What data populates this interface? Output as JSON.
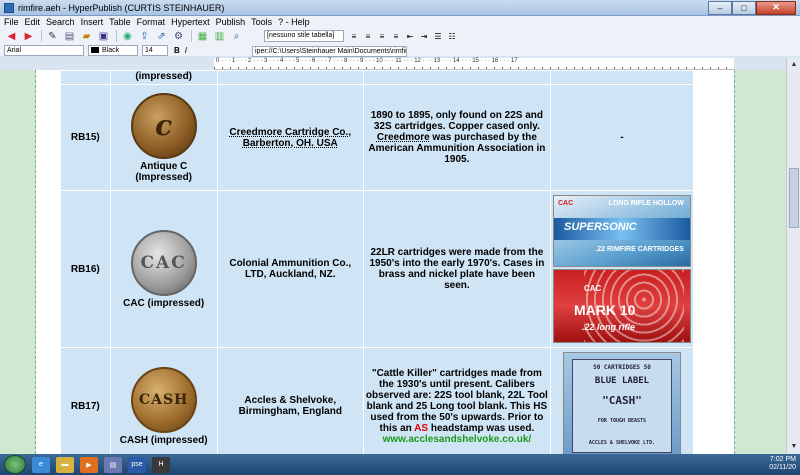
{
  "window": {
    "title": "rimfire.aeh - HyperPublish (CURTIS STEINHAUER)"
  },
  "menu": [
    "File",
    "Edit",
    "Search",
    "Insert",
    "Table",
    "Format",
    "Hypertext",
    "Publish",
    "Tools",
    "? - Help"
  ],
  "toolbar": {
    "style_select": "[nessuno stile tabella]",
    "font": "Arial",
    "color": "Black",
    "size": "14",
    "bold": "B",
    "italic": "I",
    "path": "iper://C:\\Users\\Steinhauer Main\\Documents\\rimfire.aeh"
  },
  "ruler": {
    "marks": "0 · · · 1 · · · 2 · · · 3 · · · 4 · · · 5 · · · 6 · · · 7 · · · 8 · · · 9 · · · 10 · · · 11 · · · 12 · · · 13 · · · 14 · · · 15 · · · 16 · · · 17"
  },
  "rows": [
    {
      "code": "",
      "image_label": "(impressed)",
      "maker": "",
      "desc": "",
      "note": ""
    },
    {
      "code": "RB15)",
      "headstamp_glyph": "c",
      "image_label": "Antique C (Impressed)",
      "maker": "Creedmore Cartridge Co., Barberton, OH. USA",
      "desc_a": "1890 to 1895, only found on 22S and 32S cartridges. Copper cased only. ",
      "desc_b": "Creedmore",
      "desc_c": " was purchased by the American Ammunition Association in 1905.",
      "note": "-"
    },
    {
      "code": "RB16)",
      "headstamp_glyph": "CAC",
      "image_label": "CAC (impressed)",
      "maker": "Colonial Ammunition Co., LTD, Auckland, NZ.",
      "desc": "22LR cartridges were made from the 1950's into the early 1970's. Cases in brass and nickel plate have been seen.",
      "box1": {
        "logo": "CAC",
        "top": "LONG RIFLE HOLLOW",
        "brand": "SUPERSONIC",
        "bottom": ".22 RIMFIRE CARTRIDGES"
      },
      "box2": {
        "logo": "CAC",
        "brand": "MARK 10",
        "sub": ".22 long rifle"
      }
    },
    {
      "code": "RB17)",
      "headstamp_glyph": "CASH",
      "image_label": "CASH (impressed)",
      "maker": "Accles & Shelvoke, Birmingham, England",
      "desc_a": "\"Cattle Killer\" cartridges made from the 1930's until present. Calibers observed are: 22S tool blank, 22L Tool blank and 25 Long tool blank. This HS used from the 50's upwards. Prior to this an ",
      "desc_red": "AS",
      "desc_b": " headstamp was used.",
      "desc_link": "www.acclesandshelvoke.co.uk/",
      "box3": {
        "l1": "50 CARTRIDGES 50",
        "l2": "BLUE LABEL",
        "l3": "\"CASH\"",
        "l4": "FOR TOUGH BEASTS",
        "l5": "ACCLES & SHELVOKE LTD."
      }
    }
  ],
  "taskbar": {
    "time": "7:02 PM",
    "date": "02/11/20"
  }
}
